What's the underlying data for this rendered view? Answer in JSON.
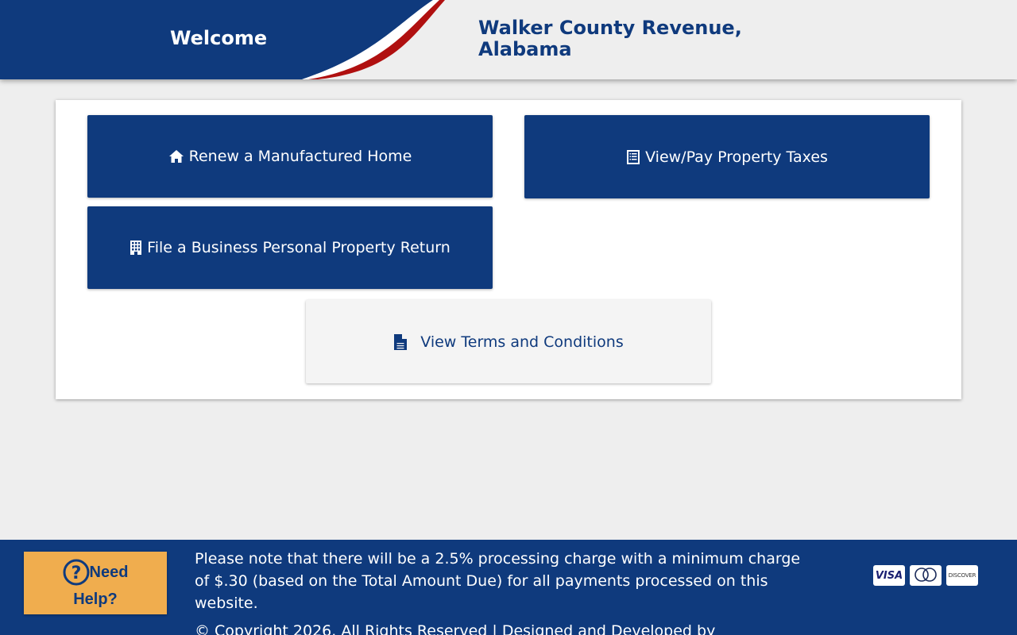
{
  "header": {
    "welcome": "Welcome",
    "title": "Walker County Revenue, Alabama"
  },
  "tiles": {
    "renew": {
      "label": "Renew a Manufactured Home",
      "icon": "home-icon"
    },
    "view_pay": {
      "label": "View/Pay Property Taxes",
      "icon": "list-icon"
    },
    "business": {
      "label": "File a Business Personal Property Return",
      "icon": "building-icon"
    },
    "terms": {
      "label": "View Terms and Conditions",
      "icon": "document-icon"
    }
  },
  "footer": {
    "help_line1": "Need",
    "help_line2": "Help?",
    "note": "Please note that there will be a 2.5% processing charge with a minimum charge of $.30 (based on the Total Amount Due) for all payments processed on this website.",
    "copyright": "© Copyright 2026. All Rights Reserved  |  Designed and Developed by",
    "payment_cards": [
      "VISA",
      "MasterCard",
      "DISCOVER"
    ]
  },
  "colors": {
    "brand_blue": "#0f3a7d",
    "accent_red": "#b01010",
    "help_orange": "#f0ad4e",
    "background": "#eeeeee"
  }
}
